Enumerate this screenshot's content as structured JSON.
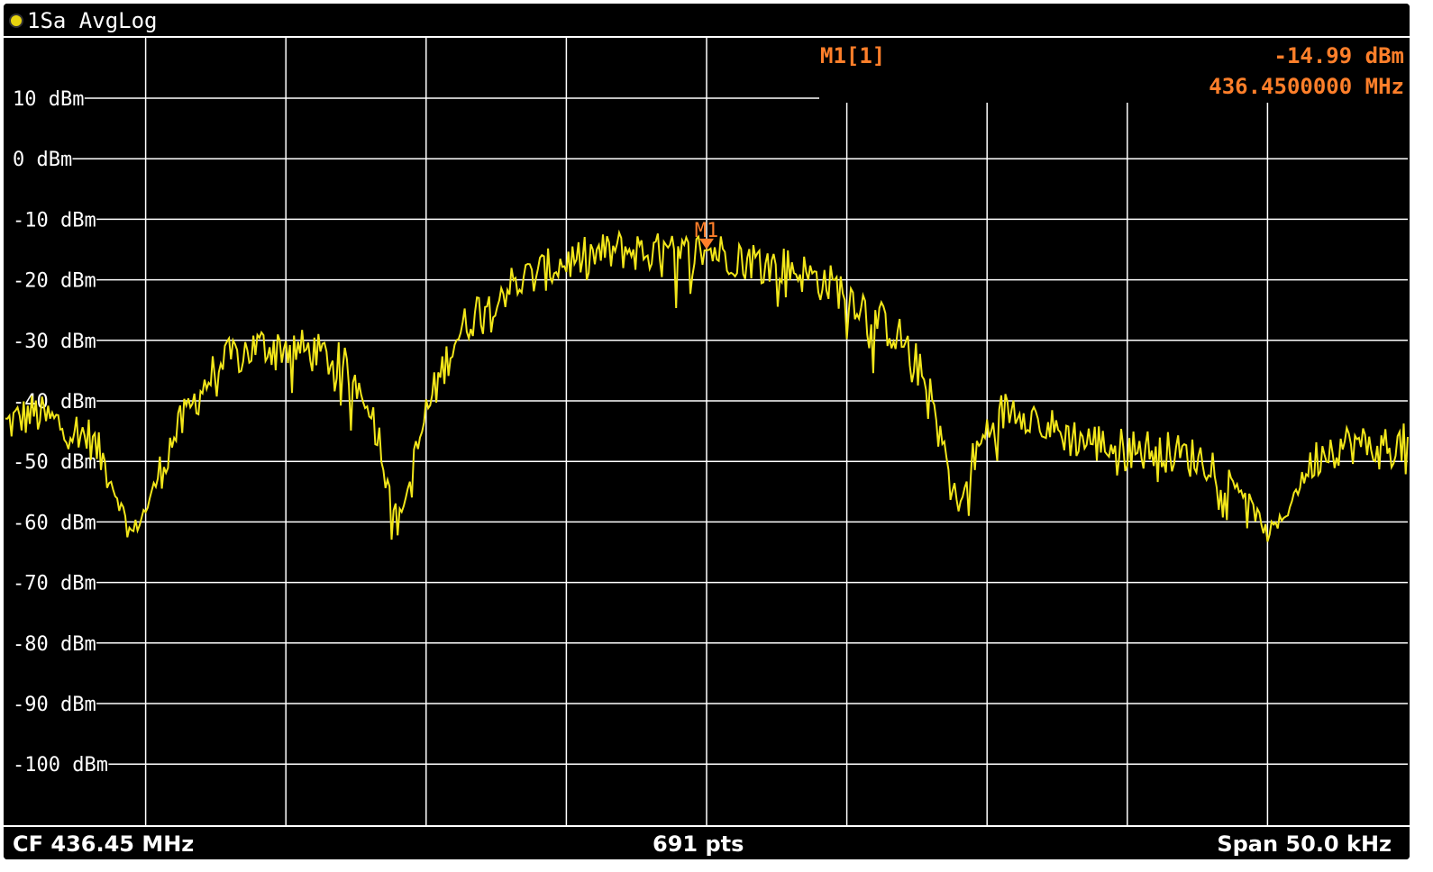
{
  "window": {
    "title": "1Sa AvgLog"
  },
  "marker_info": {
    "name": "M1[1]",
    "level": "-14.99 dBm",
    "frequency": "436.4500000 MHz",
    "marker_label": "M1"
  },
  "footer": {
    "center_frequency": "CF 436.45 MHz",
    "points": "691 pts",
    "span": "Span 50.0 kHz"
  },
  "colors": {
    "background": "#000000",
    "grid": "#ffffff",
    "trace": "#f2e61a",
    "marker": "#ff7f2a"
  },
  "chart_data": {
    "type": "line",
    "title": "1Sa AvgLog",
    "xlabel": "",
    "ylabel": "",
    "xlim": [
      -25,
      25
    ],
    "ylim": [
      -110,
      20
    ],
    "y_ticks": [
      "10 dBm",
      "0 dBm",
      "-10 dBm",
      "-20 dBm",
      "-30 dBm",
      "-40 dBm",
      "-50 dBm",
      "-60 dBm",
      "-70 dBm",
      "-80 dBm",
      "-90 dBm",
      "-100 dBm"
    ],
    "grid": true,
    "marker": {
      "x": 0,
      "y": -14.99
    },
    "series": [
      {
        "name": "1Sa AvgLog",
        "x": [
          -25,
          -24,
          -23,
          -22,
          -21.5,
          -21,
          -20.5,
          -20,
          -19.5,
          -19,
          -18.5,
          -18,
          -17.5,
          -17,
          -16,
          -15,
          -14,
          -13,
          -12,
          -11.5,
          -11,
          -10.5,
          -10,
          -9.5,
          -9,
          -8,
          -7,
          -6,
          -5,
          -4,
          -3,
          -2,
          -1,
          0,
          1,
          2,
          3,
          4,
          5,
          6,
          7,
          7.5,
          8,
          8.5,
          9,
          9.5,
          10,
          10.5,
          11,
          11.5,
          12,
          13,
          14,
          15,
          16,
          17,
          18,
          19,
          19.5,
          20,
          20.5,
          21,
          21.5,
          22,
          23,
          24,
          25
        ],
        "y": [
          -44,
          -42,
          -44,
          -46,
          -50,
          -56,
          -62,
          -58,
          -52,
          -46,
          -42,
          -38,
          -35,
          -33,
          -31,
          -31,
          -32,
          -34,
          -40,
          -50,
          -60,
          -52,
          -42,
          -36,
          -30,
          -24,
          -21,
          -19,
          -17,
          -16,
          -15,
          -15.5,
          -16,
          -15,
          -16,
          -17,
          -18,
          -20,
          -22,
          -26,
          -30,
          -34,
          -40,
          -48,
          -58,
          -50,
          -45,
          -42,
          -41,
          -42,
          -44,
          -46,
          -47,
          -48,
          -48,
          -49,
          -50,
          -54,
          -58,
          -62,
          -60,
          -55,
          -51,
          -48,
          -47,
          -48,
          -47
        ]
      }
    ]
  }
}
